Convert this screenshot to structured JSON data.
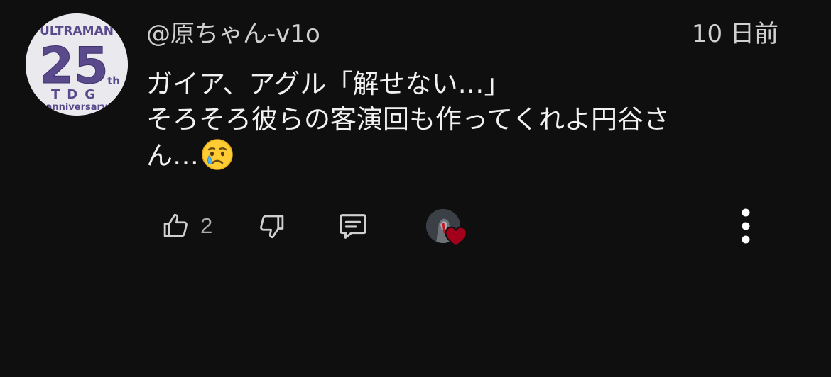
{
  "comment": {
    "author": "@原ちゃん-v1o",
    "timestamp": "10 日前",
    "avatar_text": {
      "top": "ULTRAMAN",
      "number": "25",
      "suffix": "th",
      "middle": "TDG",
      "bottom": "anniversary"
    },
    "body_lines": [
      "ガイア、アグル「解せない…」",
      "そろそろ彼らの客演回も作ってくれよ円谷さ",
      "ん…"
    ],
    "emoji": "crying-face",
    "like_count": "2"
  },
  "icons": {
    "like": "thumbs-up-icon",
    "dislike": "thumbs-down-icon",
    "reply": "reply-comment-icon",
    "creator_heart": "creator-heart-icon",
    "more": "more-vertical-icon"
  },
  "colors": {
    "background": "#0f0f0f",
    "text_primary": "#f1f1f1",
    "text_secondary": "#aaaaaa",
    "heart": "#a3001b",
    "avatar_purple": "#5a4a8c"
  }
}
